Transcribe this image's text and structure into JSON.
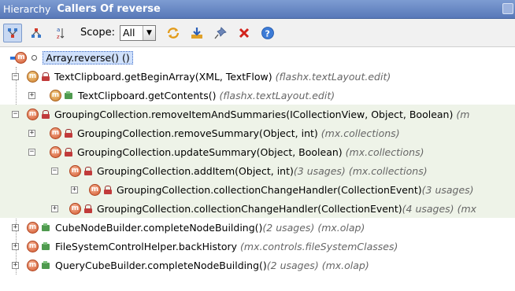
{
  "window": {
    "view_name": "Hierarchy",
    "title": "Callers Of reverse"
  },
  "toolbar": {
    "scope_label": "Scope:",
    "scope_value": "All",
    "icons": [
      "caller-hierarchy-icon",
      "callee-hierarchy-icon",
      "sort-alpha-icon",
      "refresh-icon",
      "export-icon",
      "pin-icon",
      "close-icon",
      "help-icon"
    ]
  },
  "tree": {
    "rows": [
      {
        "text": "Array.reverse() ()",
        "pkg": "",
        "usages": ""
      },
      {
        "text": "TextClipboard.getBeginArray(XML, TextFlow)",
        "usages": "",
        "pkg": "(flashx.textLayout.edit)"
      },
      {
        "text": "TextClipboard.getContents()",
        "usages": "",
        "pkg": "(flashx.textLayout.edit)"
      },
      {
        "text": "GroupingCollection.removeItemAndSummaries(ICollectionView, Object, Boolean)",
        "usages": "",
        "pkg": "(m"
      },
      {
        "text": "GroupingCollection.removeSummary(Object, int)",
        "usages": "",
        "pkg": "(mx.collections)"
      },
      {
        "text": "GroupingCollection.updateSummary(Object, Boolean)",
        "usages": "",
        "pkg": "(mx.collections)"
      },
      {
        "text": "GroupingCollection.addItem(Object, int)",
        "usages": "(3 usages)",
        "pkg": "(mx.collections)"
      },
      {
        "text": "GroupingCollection.collectionChangeHandler(CollectionEvent)",
        "usages": "(3 usages)",
        "pkg": ""
      },
      {
        "text": "GroupingCollection.collectionChangeHandler(CollectionEvent)",
        "usages": "(4 usages)",
        "pkg": "(mx"
      },
      {
        "text": "CubeNodeBuilder.completeNodeBuilding()",
        "usages": "(2 usages)",
        "pkg": "(mx.olap)"
      },
      {
        "text": "FileSystemControlHelper.backHistory",
        "usages": "",
        "pkg": "(mx.controls.fileSystemClasses)"
      },
      {
        "text": "QueryCubeBuilder.completeNodeBuilding()",
        "usages": "(2 usages)",
        "pkg": "(mx.olap)"
      }
    ]
  }
}
